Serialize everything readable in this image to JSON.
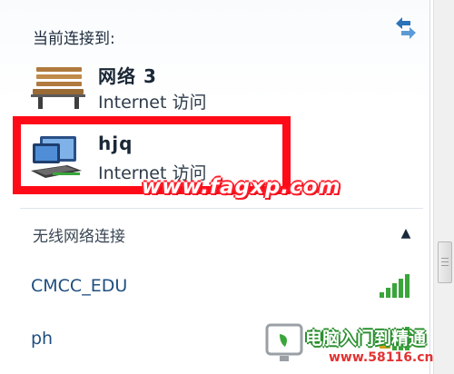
{
  "header": {
    "label": "当前连接到:"
  },
  "connections": [
    {
      "name": "网络 3",
      "access": "Internet 访问",
      "icon": "bench-icon"
    },
    {
      "name": "hjq",
      "access": "Internet 访问",
      "icon": "network-computer-icon"
    }
  ],
  "wireless": {
    "label": "无线网络连接",
    "networks": [
      {
        "ssid": "CMCC_EDU",
        "icon": "signal-bars-icon"
      },
      {
        "ssid": "ph",
        "icon": "secured-signal-icon"
      }
    ]
  },
  "watermarks": {
    "url": "www.fagxp.com",
    "brand": "电脑入门到精通",
    "site": "www.58116.cn"
  },
  "colors": {
    "highlight": "#ff0b18",
    "link": "#1f4e80",
    "signal": "#3aa53a"
  }
}
